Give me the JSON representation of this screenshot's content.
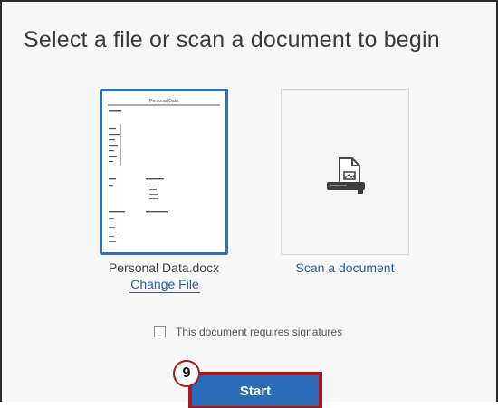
{
  "dialog": {
    "title": "Select a file or scan a document to begin"
  },
  "selected_file": {
    "preview_heading": "Personal Data",
    "file_name": "Personal Data.docx",
    "change_label": "Change File"
  },
  "scan": {
    "label": "Scan a document",
    "icon": "scanner-icon"
  },
  "signatures": {
    "label": "This document requires signatures",
    "checked": false
  },
  "callout": {
    "step_number": "9"
  },
  "actions": {
    "start_label": "Start"
  },
  "colors": {
    "accent_blue": "#2b6cb8",
    "selected_border": "#2a74c3",
    "highlight_red": "#b0151c",
    "link_blue": "#2a5e9e"
  }
}
